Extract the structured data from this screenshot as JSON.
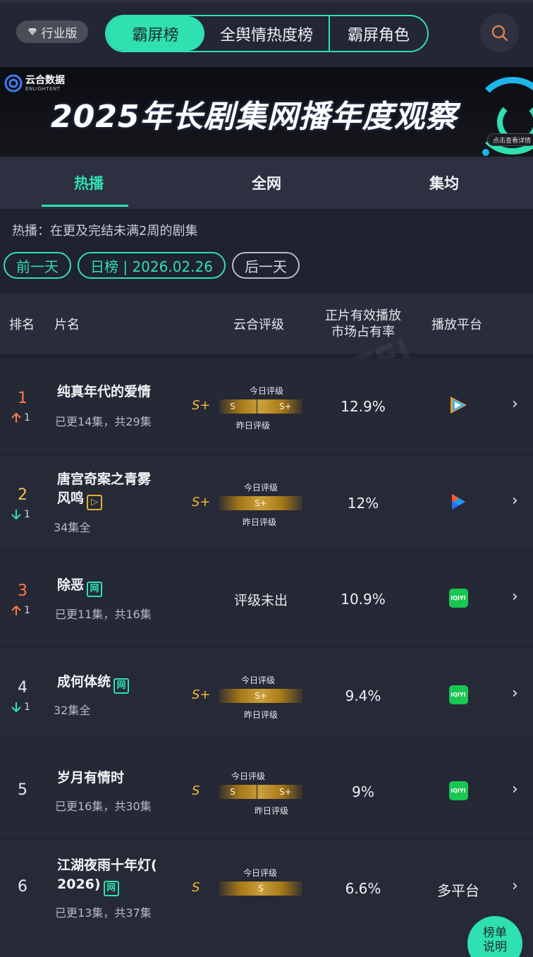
{
  "header": {
    "edition_label": "行业版",
    "segments": [
      "霸屏榜",
      "全舆情热度榜",
      "霸屏角色"
    ],
    "active_segment": "霸屏榜",
    "search_icon": "search-icon"
  },
  "banner": {
    "logo_cn": "云合数据",
    "logo_en": "ENLIGHTENT",
    "title": "2025年长剧集网播年度观察",
    "detail_label": "点击查看详情"
  },
  "tabs": [
    "热播",
    "全网",
    "集均"
  ],
  "active_tab": "热播",
  "note": "热播：在更及完结未满2周的剧集",
  "date_nav": {
    "prev": "前一天",
    "current": "日榜 | 2026.02.26",
    "next": "后一天"
  },
  "columns": {
    "rank": "排名",
    "title": "片名",
    "grade": "云合评级",
    "share_line1": "正片有效播放",
    "share_line2": "市场占有率",
    "platform": "播放平台"
  },
  "labels": {
    "today": "今日评级",
    "yesterday": "昨日评级",
    "pending": "评级未出"
  },
  "rows": [
    {
      "rank": "1",
      "change_dir": "up",
      "change": "1",
      "title": "纯真年代的爱情",
      "tag": "",
      "status": "已更14集，共29集",
      "grade": "S+",
      "bar_left": "S",
      "bar_right": "S+",
      "share": "12.9%",
      "platform": "tencent-video-icon"
    },
    {
      "rank": "2",
      "change_dir": "down",
      "change": "1",
      "title_line1": "唐宫奇案之青雾",
      "title_line2": "风鸣",
      "tag": "play-badge-icon",
      "status": "34集全",
      "grade": "S+",
      "bar_center": "S+",
      "share": "12%",
      "platform": "youku-icon"
    },
    {
      "rank": "3",
      "change_dir": "up",
      "change": "1",
      "title": "除恶",
      "tag": "网",
      "status": "已更11集，共16集",
      "grade": "",
      "share": "10.9%",
      "platform": "iqiyi-icon"
    },
    {
      "rank": "4",
      "change_dir": "down",
      "change": "1",
      "title": "成何体统",
      "tag": "网",
      "status": "32集全",
      "grade": "S+",
      "bar_center": "S+",
      "share": "9.4%",
      "platform": "iqiyi-icon"
    },
    {
      "rank": "5",
      "change_dir": "",
      "change": "",
      "title": "岁月有情时",
      "tag": "",
      "status": "已更16集，共30集",
      "grade": "S",
      "bar_left": "S",
      "bar_right": "S+",
      "share": "9%",
      "platform": "iqiyi-icon"
    },
    {
      "rank": "6",
      "change_dir": "",
      "change": "",
      "title_line1": "江湖夜雨十年灯(",
      "title_line2": "2026)",
      "tag": "网",
      "status": "已更13集，共37集",
      "grade": "S",
      "bar_center": "S",
      "share": "6.6%",
      "platform_text": "多平台"
    }
  ],
  "platform_iqiyi_label": "iQIYI",
  "rules_button": "榜单说明",
  "colors": {
    "accent": "#2fe0b0",
    "gold": "#f3b833",
    "up": "#ff7a45",
    "background": "#1f2230"
  }
}
